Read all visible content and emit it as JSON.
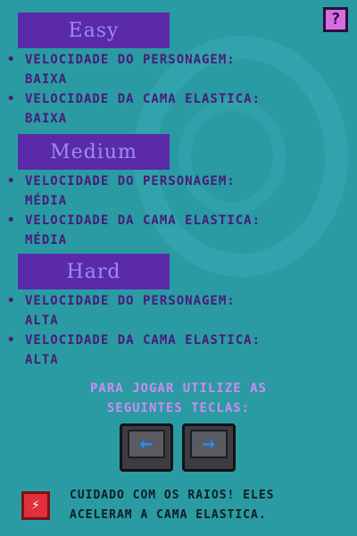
{
  "help_button": {
    "icon": "question-icon",
    "label": "?"
  },
  "difficulties": [
    {
      "title": "Easy",
      "lines": [
        "VELOCIDADE DO PERSONAGEM:",
        "BAIXA",
        "VELOCIDADE DA CAMA ELASTICA:",
        "BAIXA"
      ]
    },
    {
      "title": "Medium",
      "lines": [
        "VELOCIDADE DO PERSONAGEM:",
        "MÉDIA",
        "VELOCIDADE DA CAMA ELASTICA:",
        "MÉDIA"
      ]
    },
    {
      "title": "Hard",
      "lines": [
        "VELOCIDADE DO PERSONAGEM:",
        "ALTA",
        "VELOCIDADE DA CAMA ELASTICA:",
        "ALTA"
      ]
    }
  ],
  "instructions": {
    "line1": "PARA JOGAR UTILIZE AS",
    "line2": "SEGUINTES TECLAS:"
  },
  "keys": {
    "left": "←",
    "right": "→"
  },
  "warning": {
    "icon": "lightning-bolt-icon",
    "glyph": "⚡",
    "line1": "CUIDADO COM OS RAIOS! ELES",
    "line2": "ACELERAM A CAMA ELASTICA."
  },
  "colors": {
    "background": "#2a9aa3",
    "banner": "#5b2aa8",
    "text": "#4a1a7a",
    "accent": "#cc8df0"
  }
}
